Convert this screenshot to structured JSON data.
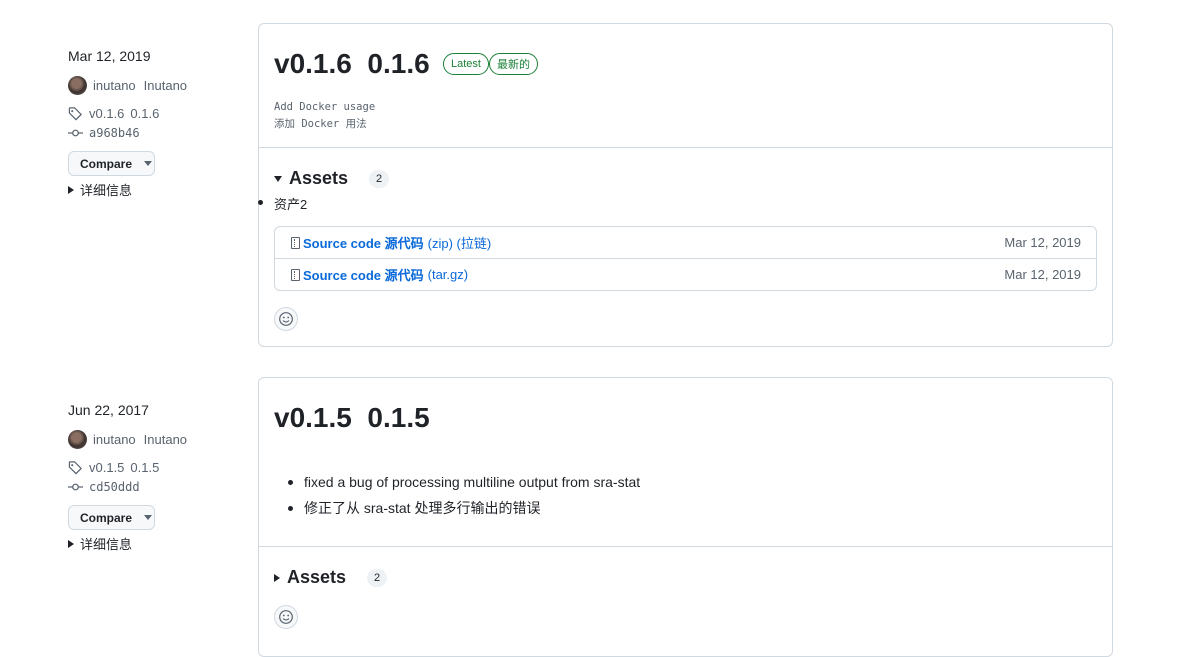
{
  "releases": [
    {
      "date": "Mar 12, 2019",
      "author_login": "inutano",
      "author_name": "Inutano",
      "tag": "v0.1.6",
      "tag_alt": "0.1.6",
      "commit": "a968b46",
      "compare_label": "Compare",
      "details_label": "详细信息",
      "title": "v0.1.6  0.1.6",
      "badges": [
        "Latest",
        "最新的"
      ],
      "notes": [
        "Add Docker usage",
        "添加 Docker 用法"
      ],
      "assets_label": "Assets",
      "assets_count": "2",
      "assets_sub": "资产2",
      "assets": [
        {
          "name": "Source code 源代码",
          "ext": "(zip) (拉链)",
          "date": "Mar 12, 2019"
        },
        {
          "name": "Source code 源代码",
          "ext": "(tar.gz)",
          "date": "Mar 12, 2019"
        }
      ]
    },
    {
      "date": "Jun 22, 2017",
      "author_login": "inutano",
      "author_name": "Inutano",
      "tag": "v0.1.5",
      "tag_alt": "0.1.5",
      "commit": "cd50ddd",
      "compare_label": "Compare",
      "details_label": "详细信息",
      "title": "v0.1.5  0.1.5",
      "bullets": [
        "fixed a bug of processing multiline output from sra-stat",
        "修正了从 sra-stat 处理多行输出的错误"
      ],
      "assets_label": "Assets",
      "assets_count": "2"
    }
  ]
}
